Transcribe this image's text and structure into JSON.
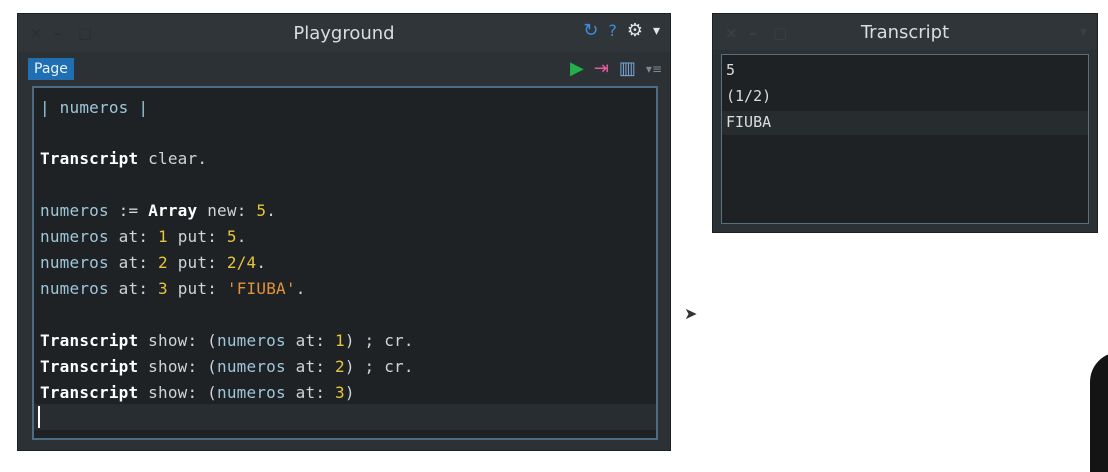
{
  "playground": {
    "window_controls": {
      "close": "×",
      "minimize": "–",
      "maximize": "□"
    },
    "title": "Playground",
    "title_icons": {
      "refresh": "↻",
      "help": "?",
      "settings": "⚙",
      "menu": "▾"
    },
    "tab_label": "Page",
    "toolbar_icons": {
      "run": "▶",
      "inspect": "⇥",
      "layout": "▥",
      "more": "▾≡"
    },
    "code": {
      "l1": "| numeros |",
      "l2_kw": "Transcript",
      "l2_rest": " clear.",
      "l3_var": "numeros",
      "l3_op": " := ",
      "l3_kw": "Array",
      "l3_msg": " new: ",
      "l3_num": "5",
      "l3_end": ".",
      "l4_var": "numeros",
      "l4_a": " at: ",
      "l4_n1": "1",
      "l4_b": " put: ",
      "l4_n2": "5",
      "l4_end": ".",
      "l5_var": "numeros",
      "l5_a": " at: ",
      "l5_n1": "2",
      "l5_b": " put: ",
      "l5_n2": "2/4",
      "l5_end": ".",
      "l6_var": "numeros",
      "l6_a": " at: ",
      "l6_n1": "3",
      "l6_b": " put: ",
      "l6_str": "'FIUBA'",
      "l6_end": ".",
      "l7_kw": "Transcript",
      "l7_a": " show: (",
      "l7_var": "numeros",
      "l7_b": " at: ",
      "l7_n": "1",
      "l7_c": ") ; cr.",
      "l8_kw": "Transcript",
      "l8_a": " show: (",
      "l8_var": "numeros",
      "l8_b": " at: ",
      "l8_n": "2",
      "l8_c": ") ; cr.",
      "l9_kw": "Transcript",
      "l9_a": " show: (",
      "l9_var": "numeros",
      "l9_b": " at: ",
      "l9_n": "3",
      "l9_c": ")"
    }
  },
  "transcript": {
    "window_controls": {
      "close": "×",
      "minimize": "–",
      "maximize": "□"
    },
    "title": "Transcript",
    "menu_icon": "▾",
    "lines": [
      "5",
      "(1/2)",
      "FIUBA"
    ]
  },
  "colors": {
    "accent": "#1f6fb2",
    "number": "#e8c53a",
    "string": "#e3923a",
    "variable": "#9fc6d9"
  }
}
